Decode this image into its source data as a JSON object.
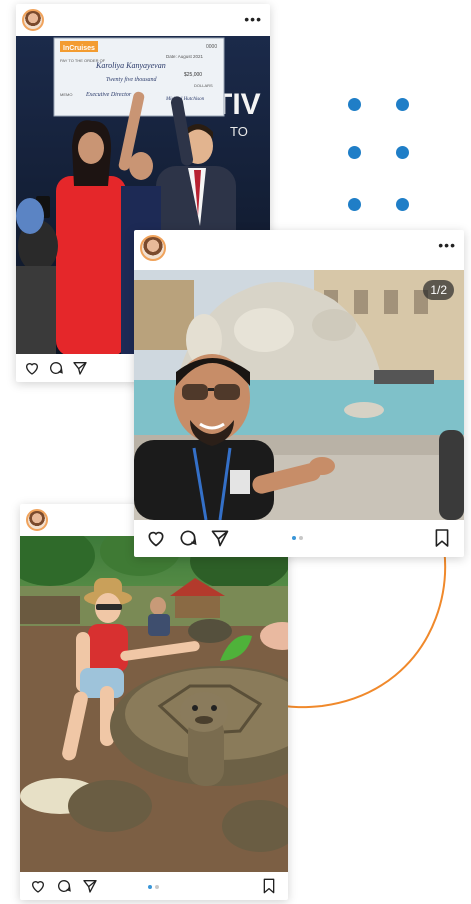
{
  "colors": {
    "accent_blue": "#1f7ec7",
    "orange_arc": "#f0892b"
  },
  "post1": {
    "menu": "•••",
    "check": {
      "brand": "InCruises",
      "number": "0000",
      "pay_to_label": "PAY TO THE ORDER OF",
      "payee": "Karoliya Kanyayevan",
      "date": "Date: August 2021",
      "amount": "$25,000",
      "amount_words": "Twenty five thousand",
      "dollars": "DOLLARS",
      "memo_label": "MEMO",
      "memo": "Executive Director",
      "signature": "Michael Hutchison"
    },
    "banner_text": "TIV",
    "banner_sub": "TO"
  },
  "post2": {
    "menu": "•••",
    "counter": "1/2"
  },
  "post3": {}
}
